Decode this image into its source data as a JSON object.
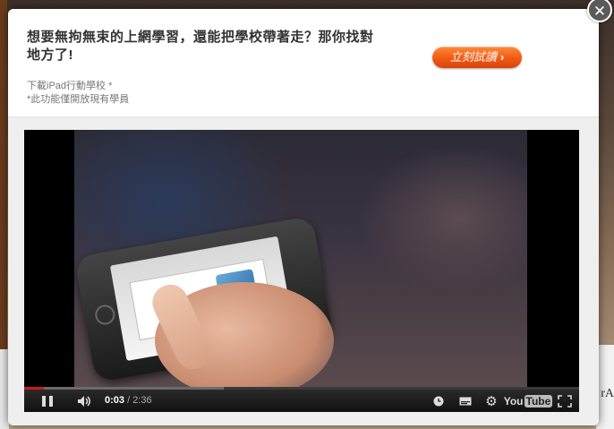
{
  "background": {
    "right_edge_text": "rA"
  },
  "modal": {
    "headline": "想要無拘無束的上網學習，還能把學校帶著走？那你找對地方了!",
    "notes": [
      "下載iPad行動學校 *",
      "*此功能僅開放現有學員"
    ],
    "cta_label": "立刻試讀",
    "cta_chevron": "›",
    "close_symbol": "✕",
    "accent_color": "#f05a12"
  },
  "player": {
    "current_time": "0:03",
    "separator": " / ",
    "duration": "2:36",
    "played_fraction": 0.035,
    "loaded_fraction": 0.36,
    "logo_you": "You",
    "logo_tube": "Tube",
    "icons": [
      "pause-icon",
      "volume-icon",
      "clock-icon",
      "captions-icon",
      "gear-icon",
      "youtube-logo",
      "fullscreen-icon"
    ]
  }
}
